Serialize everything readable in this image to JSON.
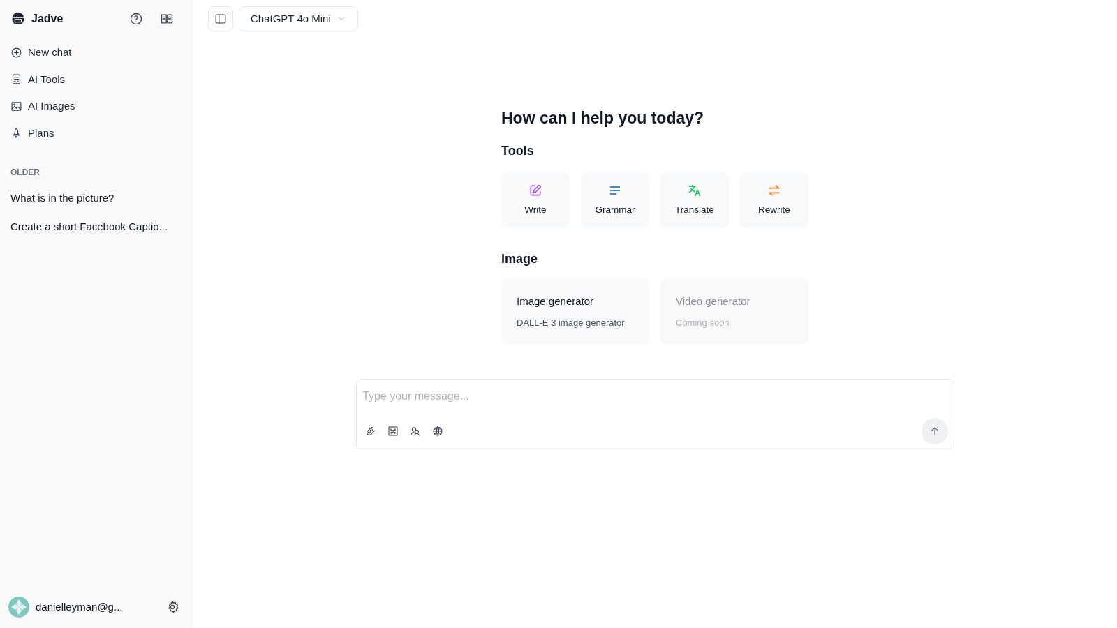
{
  "sidebar": {
    "brand": "Jadve",
    "nav": [
      {
        "kind": "plus",
        "label": "New chat"
      },
      {
        "kind": "doc",
        "label": "AI Tools"
      },
      {
        "kind": "image",
        "label": "AI Images"
      },
      {
        "kind": "rocket",
        "label": "Plans"
      }
    ],
    "section_label": "OLDER",
    "history": [
      "What is in the picture?",
      "Create a short Facebook Captio..."
    ],
    "user": {
      "email": "danielleyman@g..."
    }
  },
  "topbar": {
    "model": "ChatGPT 4o Mini"
  },
  "main": {
    "heading": "How can I help you today?",
    "tools_title": "Tools",
    "tools": [
      {
        "kind": "write",
        "label": "Write",
        "color": "#a855f7"
      },
      {
        "kind": "grammar",
        "label": "Grammar",
        "color": "#3b82f6"
      },
      {
        "kind": "translate",
        "label": "Translate",
        "color": "#22c55e"
      },
      {
        "kind": "rewrite",
        "label": "Rewrite",
        "color": "#f97316"
      }
    ],
    "image_title": "Image",
    "image_cards": [
      {
        "title": "Image generator",
        "subtitle": "DALL-E 3 image generator",
        "disabled": false
      },
      {
        "title": "Video generator",
        "subtitle": "Coming soon",
        "disabled": true
      }
    ]
  },
  "composer": {
    "placeholder": "Type your message..."
  }
}
